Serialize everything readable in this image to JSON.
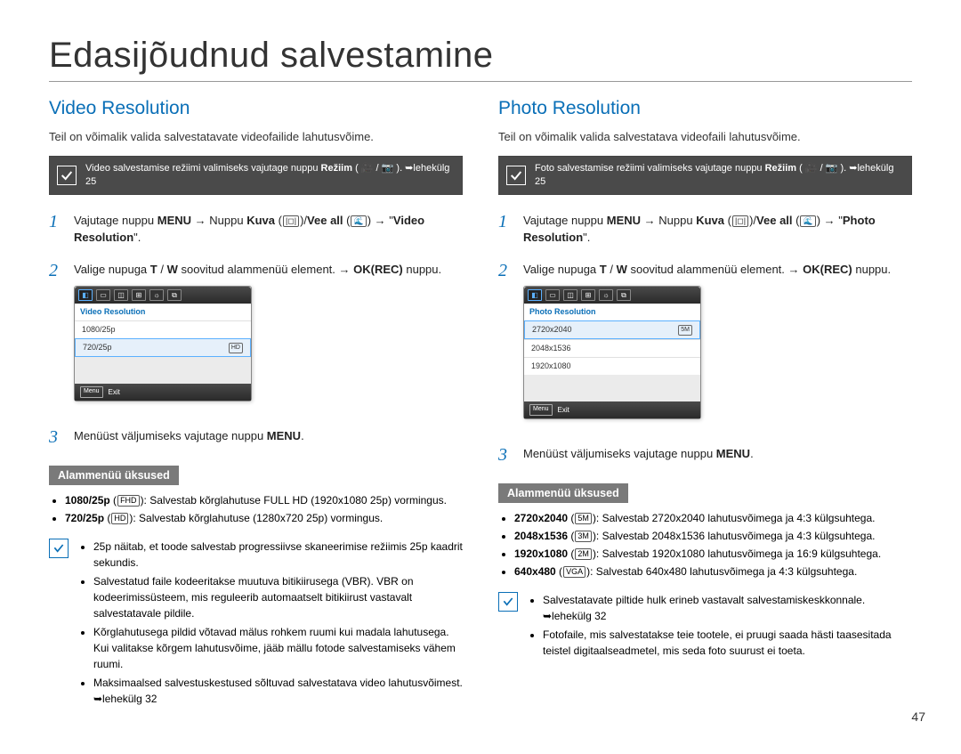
{
  "page_title": "Edasijõudnud salvestamine",
  "page_number": "47",
  "sections": [
    {
      "heading": "Video Resolution",
      "intro": "Teil on võimalik valida salvestatavate videofailide lahutusvõime.",
      "note_prefix": "Video salvestamise režiimi valimiseks vajutage nuppu ",
      "note_bold": "Režiim",
      "note_suffix": " ( 🎥 / 📷 ). ➥lehekülg 25",
      "steps": [
        "Vajutage nuppu MENU → Nuppu Kuva (|◻|) / Vee all (🌊) → \"Video Resolution\".",
        "Valige nupuga T / W soovitud alammenüü element. → OK(REC) nuppu.",
        "Menüüst väljumiseks vajutage nuppu MENU."
      ],
      "device_title": "Video Resolution",
      "device_options": [
        "1080/25p",
        "720/25p"
      ],
      "device_selected_index": 1,
      "device_exit": "Exit",
      "submenu_header": "Alammenüü üksused",
      "submenu_items": [
        "1080/25p ( 🅷🅳 ): Salvestab kõrglahutuse FULL HD (1920x1080 25p) vormingus.",
        "720/25p ( 🅷🅳 ): Salvestab kõrglahutuse (1280x720 25p) vormingus."
      ],
      "tips": [
        "25p näitab, et toode salvestab progressiivse skaneerimise režiimis 25p kaadrit sekundis.",
        "Salvestatud faile kodeeritakse muutuva bitikiirusega (VBR). VBR on kodeerimissüsteem, mis reguleerib automaatselt bitikiirust vastavalt salvestatavale pildile.",
        "Kõrglahutusega pildid võtavad mälus rohkem ruumi kui madala lahutusega. Kui valitakse kõrgem lahutusvõime, jääb mällu fotode salvestamiseks vähem ruumi.",
        "Maksimaalsed salvestuskestused sõltuvad salvestatava video lahutusvõimest. ➥lehekülg 32"
      ]
    },
    {
      "heading": "Photo Resolution",
      "intro": "Teil on võimalik valida salvestatava videofaili lahutusvõime.",
      "note_prefix": "Foto salvestamise režiimi valimiseks vajutage nuppu ",
      "note_bold": "Režiim",
      "note_suffix": " ( 🎥 / 📷 ). ➥lehekülg 25",
      "steps": [
        "Vajutage nuppu MENU → Nuppu Kuva (|◻|) / Vee all (🌊) → \"Photo Resolution\".",
        "Valige nupuga T / W soovitud alammenüü element. → OK(REC) nuppu.",
        "Menüüst väljumiseks vajutage nuppu MENU."
      ],
      "device_title": "Photo Resolution",
      "device_options": [
        "2720x2040",
        "2048x1536",
        "1920x1080"
      ],
      "device_selected_index": 0,
      "device_exit": "Exit",
      "submenu_header": "Alammenüü üksused",
      "submenu_items": [
        "2720x2040 ( 5ᴹ ): Salvestab 2720x2040 lahutusvõimega ja 4:3 külgsuhtega.",
        "2048x1536 ( 3ᴹ ): Salvestab 2048x1536 lahutusvõimega ja 4:3 külgsuhtega.",
        "1920x1080 ( 2ᴹ ): Salvestab 1920x1080 lahutusvõimega ja 16:9 külgsuhtega.",
        "640x480 ( ᴠɢᴀ ): Salvestab 640x480 lahutusvõimega ja 4:3 külgsuhtega."
      ],
      "tips": [
        "Salvestatavate piltide hulk erineb vastavalt salvestamiskeskkonnale. ➥lehekülg 32",
        "Fotofaile, mis salvestatakse teie tootele, ei pruugi saada hästi taasesitada teistel digitaalseadmetel, mis seda foto suurust ei toeta."
      ]
    }
  ]
}
